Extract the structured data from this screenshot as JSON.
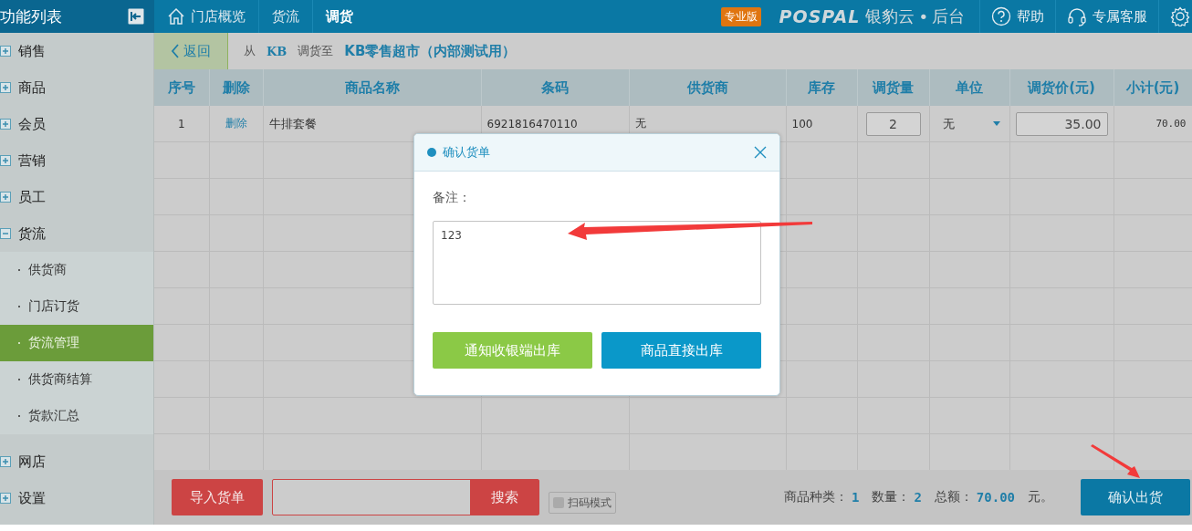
{
  "topbar": {
    "panel_title": "功能列表",
    "breadcrumbs": [
      {
        "label": "门店概览",
        "kind": "home"
      },
      {
        "label": "货流",
        "kind": "link"
      },
      {
        "label": "调货",
        "kind": "current"
      }
    ],
    "edition_badge": "专业版",
    "logo_text": "POSPAL",
    "product_name": "银豹云",
    "product_dot": "•",
    "product_suffix": "后台",
    "actions": [
      {
        "label": "帮助",
        "kind": "help"
      },
      {
        "label": "专属客服",
        "kind": "headset"
      }
    ]
  },
  "sidebar": {
    "items": [
      {
        "label": "销售",
        "expanded": false
      },
      {
        "label": "商品",
        "expanded": false
      },
      {
        "label": "会员",
        "expanded": false
      },
      {
        "label": "营销",
        "expanded": false
      },
      {
        "label": "员工",
        "expanded": false
      },
      {
        "label": "货流",
        "expanded": true,
        "children": [
          {
            "label": "供货商",
            "selected": false
          },
          {
            "label": "门店订货",
            "selected": false
          },
          {
            "label": "货流管理",
            "selected": true
          },
          {
            "label": "供货商结算",
            "selected": false
          },
          {
            "label": "货款汇总",
            "selected": false
          }
        ]
      },
      {
        "label": "网店",
        "expanded": false
      },
      {
        "label": "设置",
        "expanded": false
      }
    ]
  },
  "transfer": {
    "back": "返回",
    "from_label": "从",
    "from": "KB",
    "to_label": "调货至",
    "to": "KB零售超市（内部测试用）"
  },
  "table": {
    "columns": [
      "序号",
      "删除",
      "商品名称",
      "条码",
      "供货商",
      "库存",
      "调货量",
      "单位",
      "调货价(元)",
      "小计(元)"
    ],
    "rows": [
      {
        "index": "1",
        "delete": "删除",
        "name": "牛排套餐",
        "barcode": "6921816470110",
        "supplier": "无",
        "stock": "100",
        "quantity": "2",
        "unit": "无",
        "price": "35.00",
        "subtotal": "70.00"
      }
    ]
  },
  "footer": {
    "import_button": "导入货单",
    "search_button": "搜索",
    "scan_mode": {
      "label": "扫码模式",
      "checked": false
    },
    "summary": [
      {
        "label": "商品种类：",
        "value": "1"
      },
      {
        "label": "数量：",
        "value": "2"
      },
      {
        "label": "总额：",
        "value": "70.00"
      }
    ],
    "currency": "元。",
    "confirm_button": "确认出货"
  },
  "dialog": {
    "title": "确认货单",
    "note_label": "备注：",
    "note_value": "123",
    "buttons": [
      {
        "label": "通知收银端出库",
        "kind": "notify"
      },
      {
        "label": "商品直接出库",
        "kind": "direct"
      }
    ]
  }
}
